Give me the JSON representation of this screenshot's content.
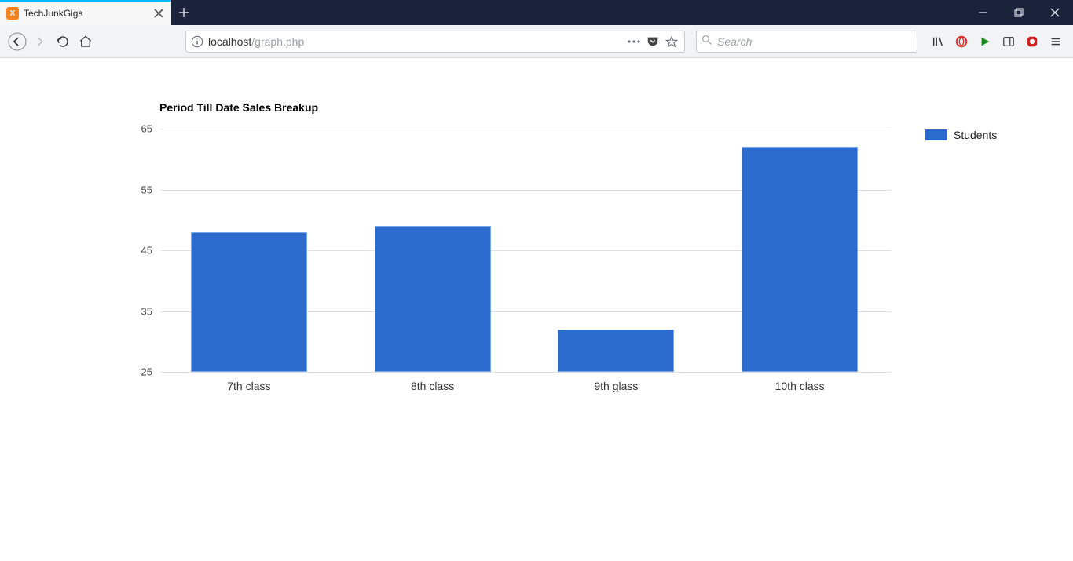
{
  "browser": {
    "tab_title": "TechJunkGigs",
    "tab_favicon_letter": "X",
    "url_host": "localhost",
    "url_path": "/graph.php",
    "search_placeholder": "Search"
  },
  "chart_data": {
    "type": "bar",
    "title": "Period Till Date Sales Breakup",
    "categories": [
      "7th class",
      "8th class",
      "9th glass",
      "10th class"
    ],
    "values": [
      48,
      49,
      32,
      62
    ],
    "series_name": "Students",
    "ylim": [
      25,
      65
    ],
    "y_ticks": [
      25,
      35,
      45,
      55,
      65
    ],
    "xlabel": "",
    "ylabel": ""
  },
  "legend": {
    "label": "Students"
  },
  "colors": {
    "bar_fill": "#2c6bce",
    "bar_stroke": "#7aa6e6",
    "grid": "#dedede",
    "titlebar_bg": "#1b233a",
    "tab_accent": "#00bcff"
  }
}
